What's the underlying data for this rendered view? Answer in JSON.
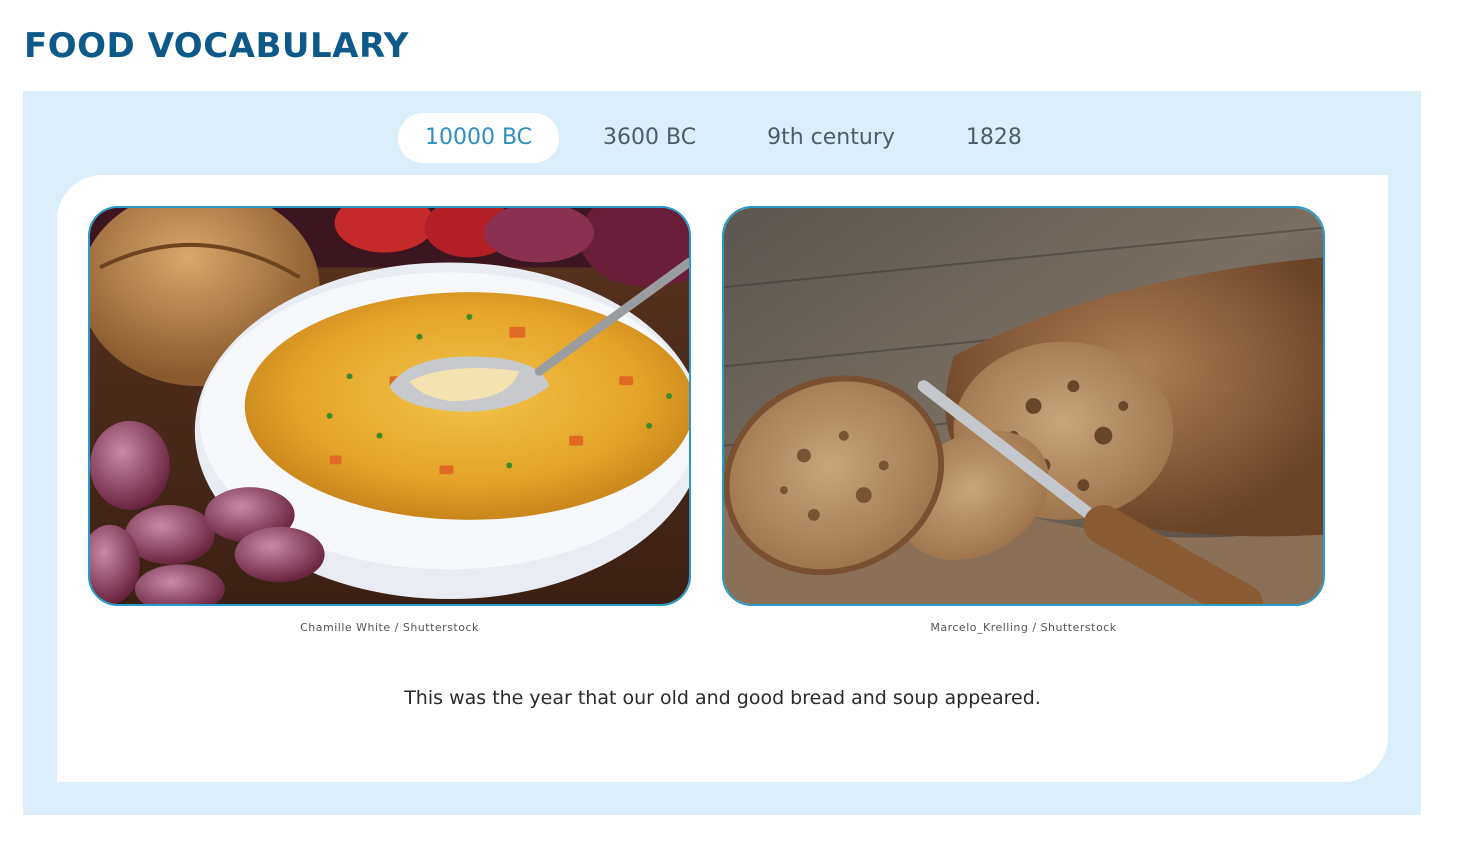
{
  "header": {
    "title": "FOOD VOCABULARY"
  },
  "tabs": [
    {
      "label": "10000 BC",
      "active": true
    },
    {
      "label": "3600 BC",
      "active": false
    },
    {
      "label": "9th century",
      "active": false
    },
    {
      "label": "1828",
      "active": false
    }
  ],
  "content": {
    "images": [
      {
        "subject": "soup",
        "credit": "Chamille White / Shutterstock"
      },
      {
        "subject": "bread",
        "credit": "Marcelo_Krelling / Shutterstock"
      }
    ],
    "description": "This was the year that our old and good bread and soup appeared."
  },
  "colors": {
    "title": "#0d5a8a",
    "panel": "#ddeefb",
    "accent": "#2d8dbf",
    "image_border": "#2a9bc8"
  }
}
